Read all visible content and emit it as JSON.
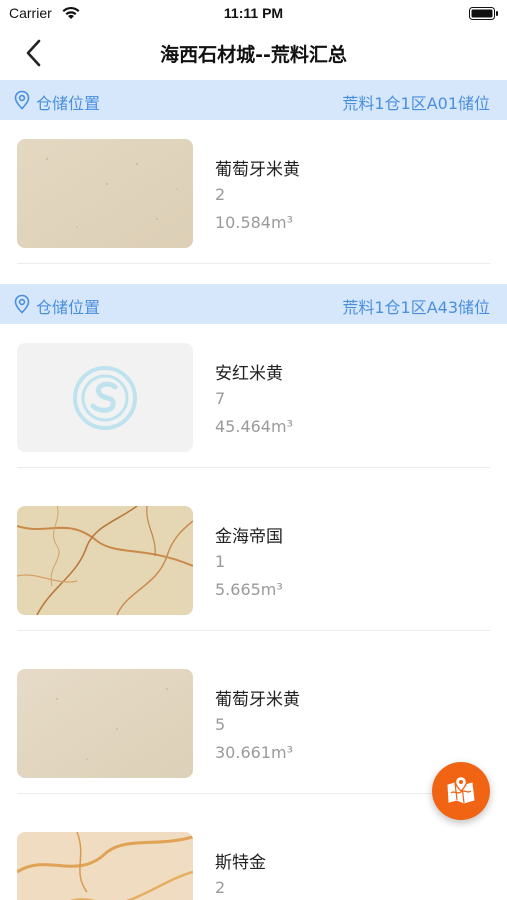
{
  "status": {
    "carrier": "Carrier",
    "time": "11:11 PM"
  },
  "nav": {
    "title": "海西石材城--荒料汇总"
  },
  "sections": [
    {
      "label": "仓储位置",
      "location": "荒料1仓1区A01储位",
      "items": [
        {
          "name": "葡萄牙米黄",
          "count": "2",
          "volume": "10.584m³",
          "thumb": "beige-stone"
        }
      ]
    },
    {
      "label": "仓储位置",
      "location": "荒料1仓1区A43储位",
      "items": [
        {
          "name": "安红米黄",
          "count": "7",
          "volume": "45.464m³",
          "thumb": "placeholder-logo"
        },
        {
          "name": "金海帝国",
          "count": "1",
          "volume": "5.665m³",
          "thumb": "gold-veined-marble"
        },
        {
          "name": "葡萄牙米黄",
          "count": "5",
          "volume": "30.661m³",
          "thumb": "beige-stone"
        },
        {
          "name": "斯特金",
          "count": "2",
          "volume": "",
          "thumb": "orange-veined-marble"
        }
      ]
    }
  ],
  "fab": {
    "icon": "map-location-icon",
    "color": "#f06414"
  },
  "colors": {
    "section_bg": "#d6e7fb",
    "accent": "#4a8fde"
  }
}
